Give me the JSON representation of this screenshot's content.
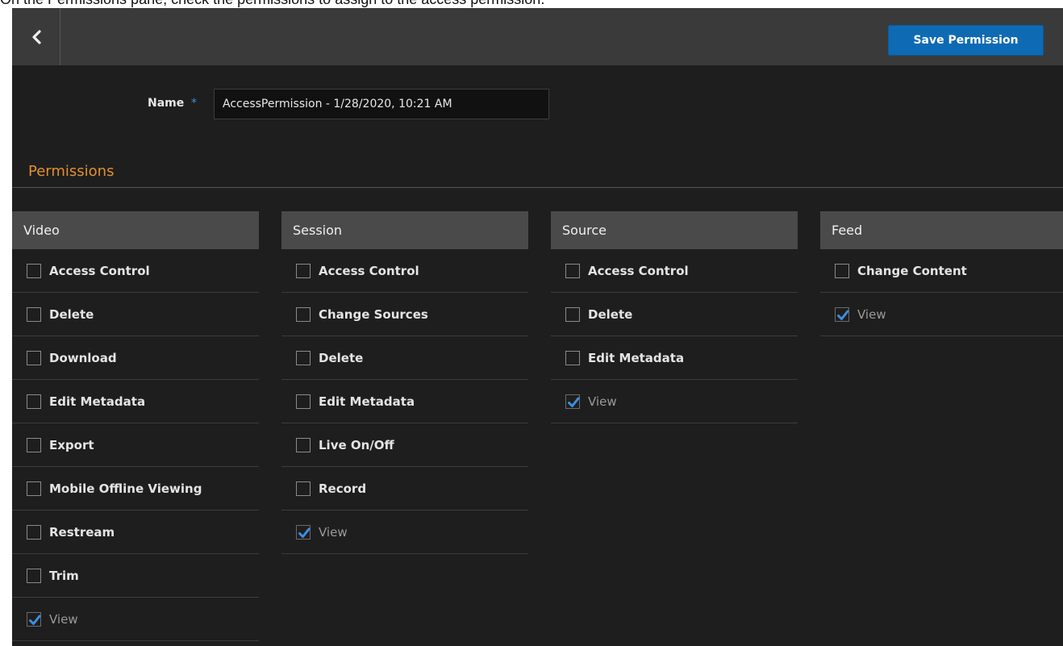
{
  "caption": "On the Permissions pane, check the permissions to assign to the access permission.",
  "toolbar": {
    "back_icon": "chevron-left-icon",
    "save_label": "Save Permission",
    "accent_color": "#0f6ab4"
  },
  "form": {
    "name_label": "Name",
    "required_mark": "*",
    "name_value": "AccessPermission - 1/28/2020, 10:21 AM"
  },
  "permissions": {
    "title": "Permissions",
    "title_color": "#e38f2d",
    "columns": [
      {
        "header": "Video",
        "items": [
          {
            "label": "Access Control",
            "checked": false
          },
          {
            "label": "Delete",
            "checked": false
          },
          {
            "label": "Download",
            "checked": false
          },
          {
            "label": "Edit Metadata",
            "checked": false
          },
          {
            "label": "Export",
            "checked": false
          },
          {
            "label": "Mobile Offline Viewing",
            "checked": false
          },
          {
            "label": "Restream",
            "checked": false
          },
          {
            "label": "Trim",
            "checked": false
          },
          {
            "label": "View",
            "checked": true
          }
        ]
      },
      {
        "header": "Session",
        "items": [
          {
            "label": "Access Control",
            "checked": false
          },
          {
            "label": "Change Sources",
            "checked": false
          },
          {
            "label": "Delete",
            "checked": false
          },
          {
            "label": "Edit Metadata",
            "checked": false
          },
          {
            "label": "Live On/Off",
            "checked": false
          },
          {
            "label": "Record",
            "checked": false
          },
          {
            "label": "View",
            "checked": true
          }
        ]
      },
      {
        "header": "Source",
        "items": [
          {
            "label": "Access Control",
            "checked": false
          },
          {
            "label": "Delete",
            "checked": false
          },
          {
            "label": "Edit Metadata",
            "checked": false
          },
          {
            "label": "View",
            "checked": true
          }
        ]
      },
      {
        "header": "Feed",
        "items": [
          {
            "label": "Change Content",
            "checked": false
          },
          {
            "label": "View",
            "checked": true
          }
        ]
      }
    ]
  }
}
